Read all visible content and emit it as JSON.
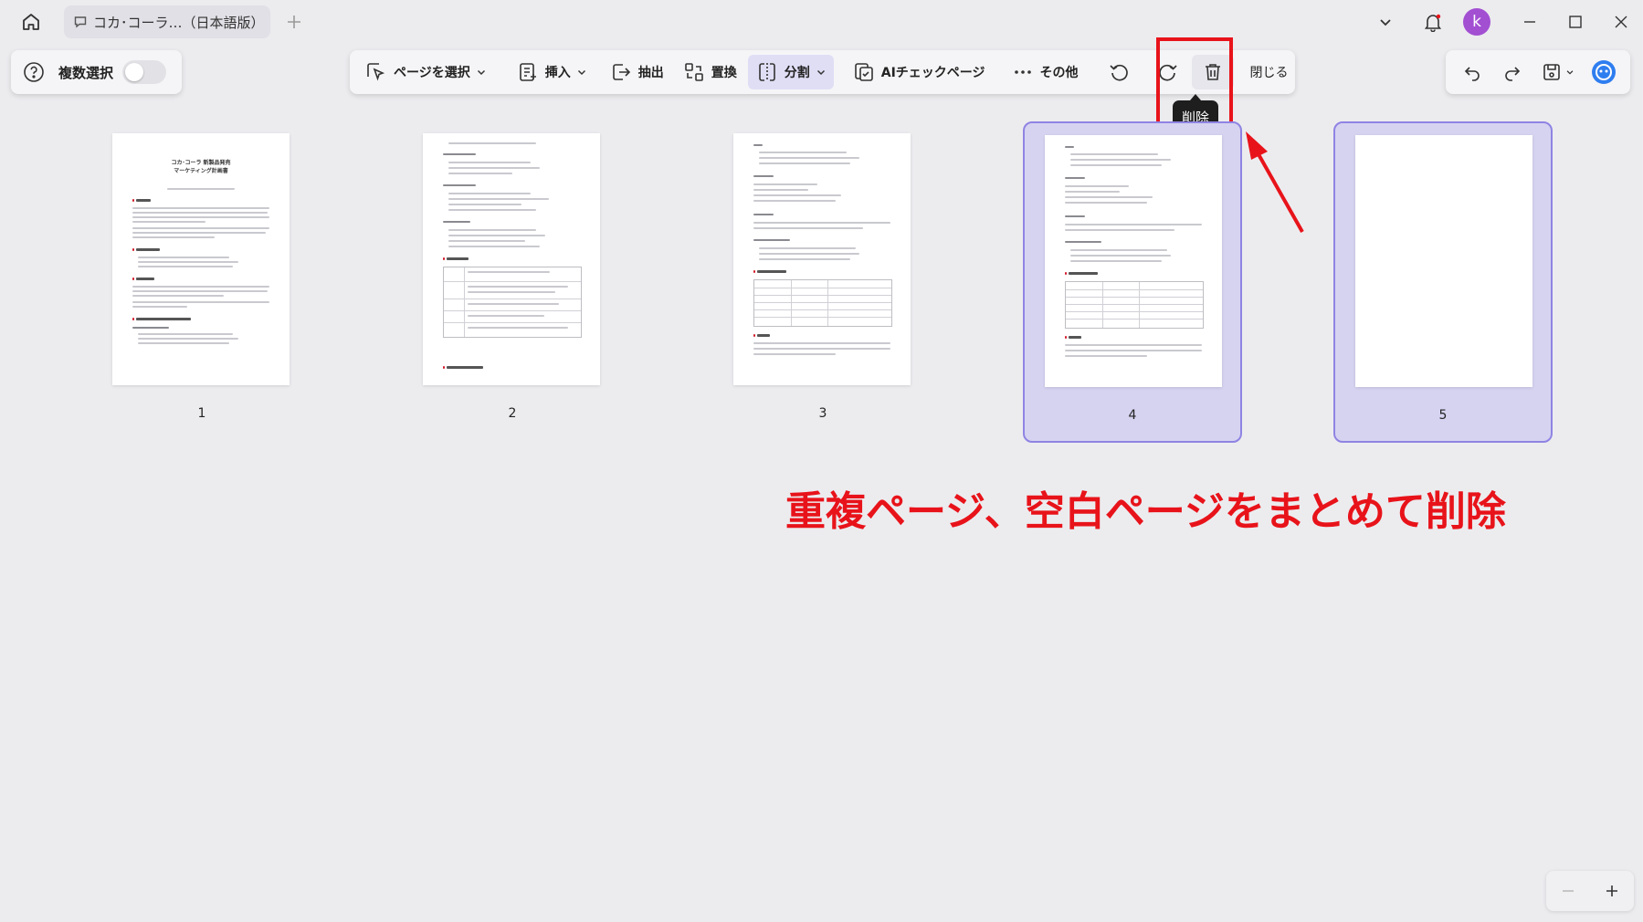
{
  "titlebar": {
    "tab_title": "コカ･コーラ…（日本語版）",
    "avatar_letter": "k"
  },
  "left_panel": {
    "multi_select_label": "複数選択"
  },
  "toolbar": {
    "select_page": "ページを選択",
    "insert": "挿入",
    "extract": "抽出",
    "replace": "置換",
    "split": "分割",
    "ai_check": "AIチェックページ",
    "more": "その他",
    "close": "閉じる",
    "delete_tooltip": "削除"
  },
  "pages": [
    {
      "number": "1",
      "selected": false,
      "title_line1": "コカ･コーラ 新製品発売",
      "title_line2": "マーケティング計画書"
    },
    {
      "number": "2",
      "selected": false
    },
    {
      "number": "3",
      "selected": false
    },
    {
      "number": "4",
      "selected": true
    },
    {
      "number": "5",
      "selected": true
    }
  ],
  "annotation": {
    "caption": "重複ページ、空白ページをまとめて削除",
    "color": "#e8131a"
  },
  "colors": {
    "accent": "#8f84e3",
    "selected_bg": "#d6d3f1",
    "avatar": "#a24fd2"
  }
}
